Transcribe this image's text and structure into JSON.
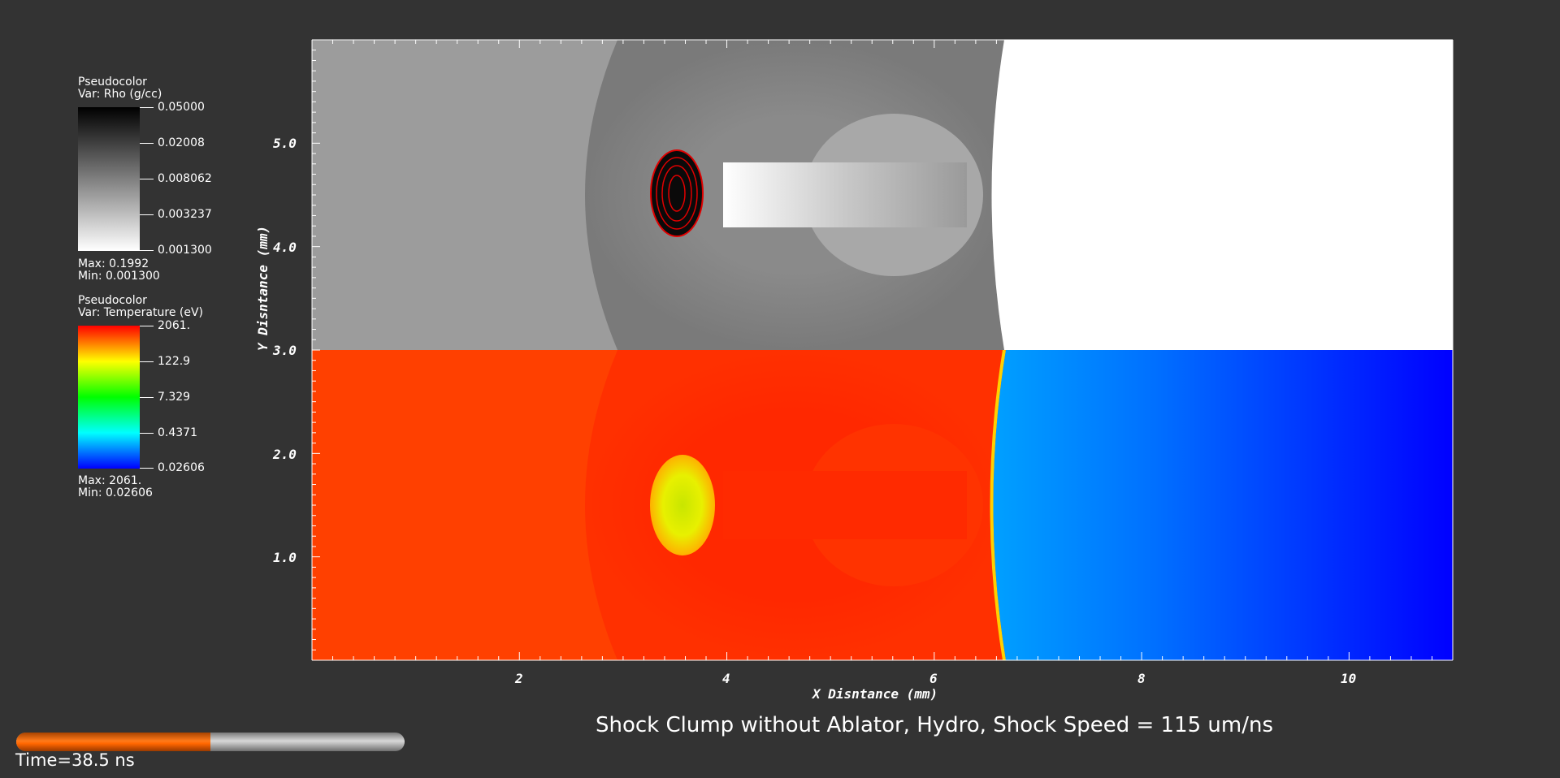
{
  "legends": [
    {
      "type_label": "Pseudocolor",
      "var_label": "Var: Rho (g/cc)",
      "ticks": [
        "0.05000",
        "0.02008",
        "0.008062",
        "0.003237",
        "0.001300"
      ],
      "max_label": "Max:  0.1992",
      "min_label": "Min:  0.001300",
      "colors": [
        "#000000",
        "#ffffff"
      ]
    },
    {
      "type_label": "Pseudocolor",
      "var_label": "Var: Temperature (eV)",
      "ticks": [
        "2061.",
        "122.9",
        "7.329",
        "0.4371",
        "0.02606"
      ],
      "max_label": "Max:  2061.",
      "min_label": "Min:  0.02606",
      "colors": [
        "#ff0000",
        "#ffff00",
        "#00ff00",
        "#00ffff",
        "#0000ff"
      ]
    }
  ],
  "plot": {
    "x_axis_label": "X Disntance (mm)",
    "y_axis_label": "Y Disntance (mm)",
    "x_ticks": [
      "2",
      "4",
      "6",
      "8",
      "10"
    ],
    "y_ticks": [
      "1.0",
      "2.0",
      "3.0",
      "4.0",
      "5.0"
    ],
    "x_range": [
      0,
      11
    ],
    "y_range": [
      0,
      6
    ],
    "density_ambient_color": "#9c9c9c",
    "density_target_color": "#ffffff",
    "temperature_hot_color": "#ff4000",
    "temperature_cold_color_left": "#00a0ff",
    "temperature_cold_color_right": "#0000ff"
  },
  "title": "Shock Clump without Ablator, Hydro, Shock Speed = 115 um/ns",
  "time": {
    "label": "Time=38.5 ns",
    "progress_fraction": 0.5
  }
}
